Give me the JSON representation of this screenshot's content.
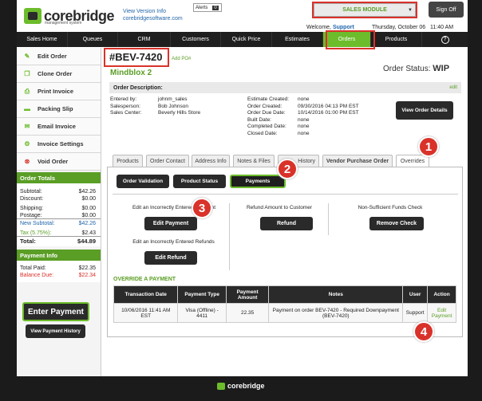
{
  "brand": {
    "name": "corebridge",
    "sub": "management system"
  },
  "header": {
    "version_link": "View Version Info",
    "site_link": "corebridgesoftware.com",
    "alerts_label": "Alerts",
    "alerts_count": "0",
    "module_select": "SALES MODULE",
    "sign_off": "Sign Off",
    "welcome": "Welcome,",
    "user": "Support",
    "datetime": "Thursday, October 06   11:40 AM"
  },
  "nav": [
    "Sales Home",
    "Queues",
    "CRM",
    "Customers",
    "Quick Price",
    "Estimates",
    "Orders",
    "Products",
    "?"
  ],
  "sidebar": {
    "items": [
      {
        "label": "Edit Order",
        "icon": "pencil-icon"
      },
      {
        "label": "Clone Order",
        "icon": "clone-icon"
      },
      {
        "label": "Print Invoice",
        "icon": "printer-icon"
      },
      {
        "label": "Packing Slip",
        "icon": "truck-icon"
      },
      {
        "label": "Email Invoice",
        "icon": "email-icon"
      },
      {
        "label": "Invoice Settings",
        "icon": "gear-icon"
      },
      {
        "label": "Void Order",
        "icon": "void-icon"
      }
    ],
    "totals_title": "Order Totals",
    "totals": [
      {
        "label": "Subtotal:",
        "value": "$42.26"
      },
      {
        "label": "Discount:",
        "value": "$0.00"
      },
      {
        "label": "Shipping:",
        "value": "$0.00"
      },
      {
        "label": "Postage:",
        "value": "$0.00"
      },
      {
        "label": "New Subtotal:",
        "value": "$42.26"
      },
      {
        "label": "Tax  (5.75%):",
        "value": "$2.43"
      },
      {
        "label": "Total:",
        "value": "$44.89"
      }
    ],
    "payment_title": "Payment Info",
    "payments": [
      {
        "label": "Total Paid:",
        "value": "$22.35"
      },
      {
        "label": "Balance Due:",
        "value": "$22.34"
      }
    ],
    "enter_payment": "Enter Payment",
    "view_history": "View Payment History"
  },
  "order": {
    "number": "#BEV-7420",
    "add_po": "Add PO#",
    "name": "Mindblox 2",
    "status_label": "Order Status:",
    "status": "WIP",
    "description_label": "Order Description:",
    "edit": "edit",
    "left_fields": [
      {
        "label": "Entered by:",
        "value": "johnm_sales"
      },
      {
        "label": "Salesperson:",
        "value": "Bob Johnson"
      },
      {
        "label": "Sales Center:",
        "value": "Beverly Hills Store"
      }
    ],
    "right_fields": [
      {
        "label": "Estimate Created:",
        "value": "none"
      },
      {
        "label": "Order Created:",
        "value": "09/30/2016 04:13 PM EST"
      },
      {
        "label": "Order Due Date:",
        "value": "10/14/2016 01:00 PM EST"
      },
      {
        "label": "Built Date:",
        "value": "none"
      },
      {
        "label": "Completed Date:",
        "value": "none"
      },
      {
        "label": "Closed Date:",
        "value": "none"
      }
    ],
    "view_details": "View Order Details"
  },
  "tabs": [
    "Products",
    "Order Contact",
    "Address Info",
    "Notes & Files",
    "History",
    "Vendor Purchase Order",
    "Overrides"
  ],
  "subtabs": [
    "Order Validation",
    "Product Status",
    "Payments"
  ],
  "overrides": {
    "edit_payment_text": "Edit an Incorrectly Entered Payment",
    "edit_payment_btn": "Edit Payment",
    "edit_refund_text": "Edit an Incorrectly Entered Refunds",
    "edit_refund_btn": "Edit Refund",
    "refund_text": "Refund Amount to Customer",
    "refund_btn": "Refund",
    "nsf_text": "Non-Sufficient Funds Check",
    "nsf_btn": "Remove Check",
    "section_title": "OVERRIDE A PAYMENT"
  },
  "payment_table": {
    "headers": [
      "Transaction Date",
      "Payment Type",
      "Payment Amount",
      "Notes",
      "User",
      "Action"
    ],
    "row": [
      "10/06/2016 11:41 AM EST",
      "Visa (Offline) - 4411",
      "22.35",
      "Payment on order BEV-7420 - Required Downpayment (BEV-7420)",
      "Support",
      "Edit Payment"
    ]
  },
  "callouts": [
    "1",
    "2",
    "3",
    "4"
  ],
  "colors": {
    "accent": "#6cbc2b",
    "callout": "#d9322a",
    "dark": "#2a2a2a"
  }
}
